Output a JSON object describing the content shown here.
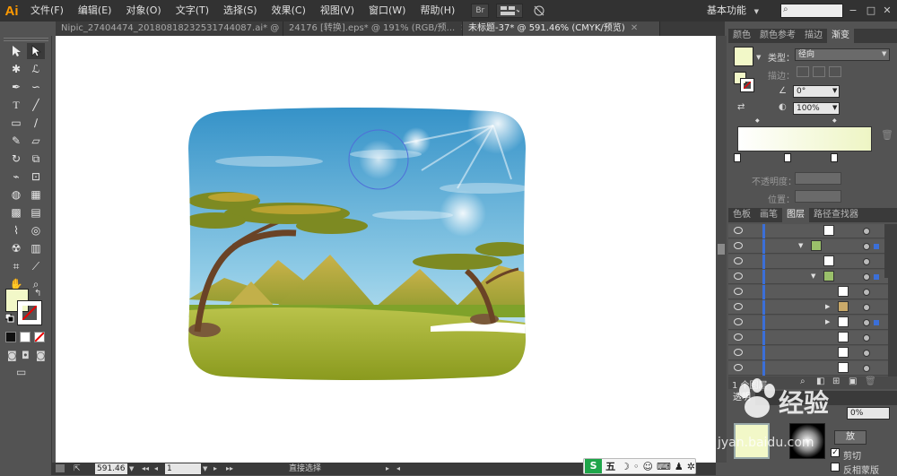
{
  "app": {
    "logo": "Ai",
    "menu": [
      "文件(F)",
      "编辑(E)",
      "对象(O)",
      "文字(T)",
      "选择(S)",
      "效果(C)",
      "视图(V)",
      "窗口(W)",
      "帮助(H)"
    ],
    "bridge_label": "Br",
    "workspace": "基本功能",
    "search_placeholder": "",
    "window_controls": [
      "−",
      "□",
      "✕"
    ]
  },
  "tabs": [
    {
      "label": "Nipic_27404474_20180818232531744087.ai* @ 150% (CMYK/预...",
      "active": false
    },
    {
      "label": "24176 [转换].eps* @ 191% (RGB/预...",
      "active": false
    },
    {
      "label": "未标题-37* @ 591.46% (CMYK/预览)",
      "active": true
    }
  ],
  "status": {
    "zoom": "591.46",
    "page": "1",
    "tool_name": "直接选择"
  },
  "gradient_panel": {
    "tabs": [
      "颜色",
      "颜色参考",
      "描边",
      "渐变"
    ],
    "active_tab": "渐变",
    "type_label": "类型：",
    "type_value": "径向",
    "stroke_label": "描边：",
    "angle_value": "0°",
    "aspect_value": "100%",
    "opacity_label": "不透明度：",
    "position_label": "位置："
  },
  "layers_panel": {
    "tabs": [
      "色板",
      "画笔",
      "图层",
      "路径查找器"
    ],
    "active_tab": "图层",
    "layer_count": "1 个图层"
  },
  "transparency_panel": {
    "tab": "透明",
    "opacity_value": "0%",
    "release_button": "放",
    "clip_label": "剪切",
    "invert_label": "反相蒙版",
    "clip_checked": true,
    "invert_checked": false
  },
  "watermark": {
    "text": "经验",
    "url": "jyan.baidu.com"
  },
  "ime": {
    "label": "五"
  },
  "colors": {
    "menubar": "#323232",
    "panel": "#535353",
    "accent_blue": "#3b6fd8",
    "logo_orange": "#ff9a00"
  }
}
